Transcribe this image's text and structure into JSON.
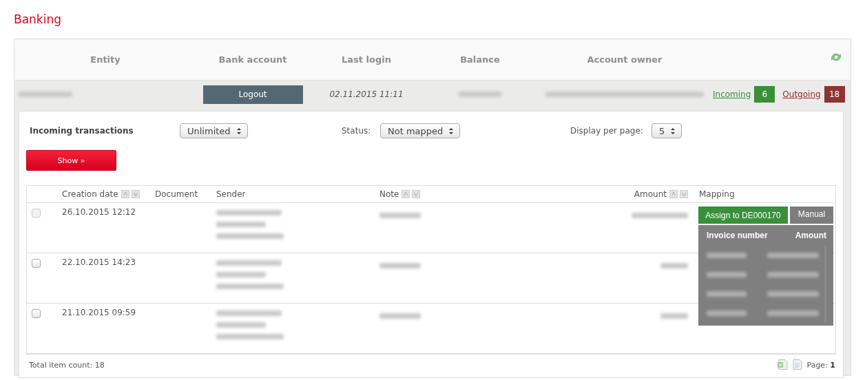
{
  "title": "Banking",
  "accounts_table": {
    "columns": [
      "Entity",
      "Bank account",
      "Last login",
      "Balance",
      "Account owner"
    ],
    "row": {
      "logout_button": "Logout",
      "last_login": "02.11.2015 11:11",
      "incoming": {
        "label": "Incoming",
        "count": "6"
      },
      "outgoing": {
        "label": "Outgoing",
        "count": "18"
      }
    }
  },
  "filters": {
    "title": "Incoming transactions",
    "period": "Unlimited",
    "status_label": "Status:",
    "status": "Not mapped",
    "per_page_label": "Display per page:",
    "per_page": "5"
  },
  "show_button": "Show »",
  "transactions": {
    "columns": [
      {
        "label": "Creation date",
        "sortable": true
      },
      {
        "label": "Document",
        "sortable": false
      },
      {
        "label": "Sender",
        "sortable": false
      },
      {
        "label": "Note",
        "sortable": true
      },
      {
        "label": "Amount",
        "sortable": true
      },
      {
        "label": "Mapping",
        "sortable": false
      }
    ],
    "rows": [
      {
        "date": "26.10.2015 12:12",
        "checked": false,
        "disabled": true
      },
      {
        "date": "22.10.2015 14:23",
        "checked": false,
        "disabled": false
      },
      {
        "date": "21.10.2015 09:59",
        "checked": false,
        "disabled": false
      }
    ]
  },
  "mapping_popup": {
    "assign_button": "Assign to DE000170",
    "manual_button": "Manual",
    "columns": [
      "Invoice number",
      "Amount"
    ]
  },
  "footer": {
    "total": "Total item count: 18",
    "page_label": "Page:",
    "page": "1"
  }
}
